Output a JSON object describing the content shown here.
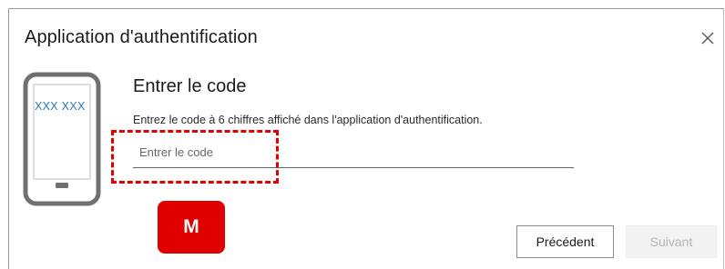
{
  "dialog": {
    "title": "Application d'authentification",
    "close_icon": "close-icon"
  },
  "phone": {
    "code_text": "XXX XXX",
    "icon": "smartphone-icon"
  },
  "content": {
    "heading": "Entrer le code",
    "description": "Entrez le code à 6 chiffres affiché dans l'application d'authentification."
  },
  "code_input": {
    "placeholder": "Entrer le code",
    "value": ""
  },
  "annotation": {
    "marker_label": "M",
    "color": "#e00000"
  },
  "buttons": {
    "back_label": "Précédent",
    "next_label": "Suivant"
  }
}
